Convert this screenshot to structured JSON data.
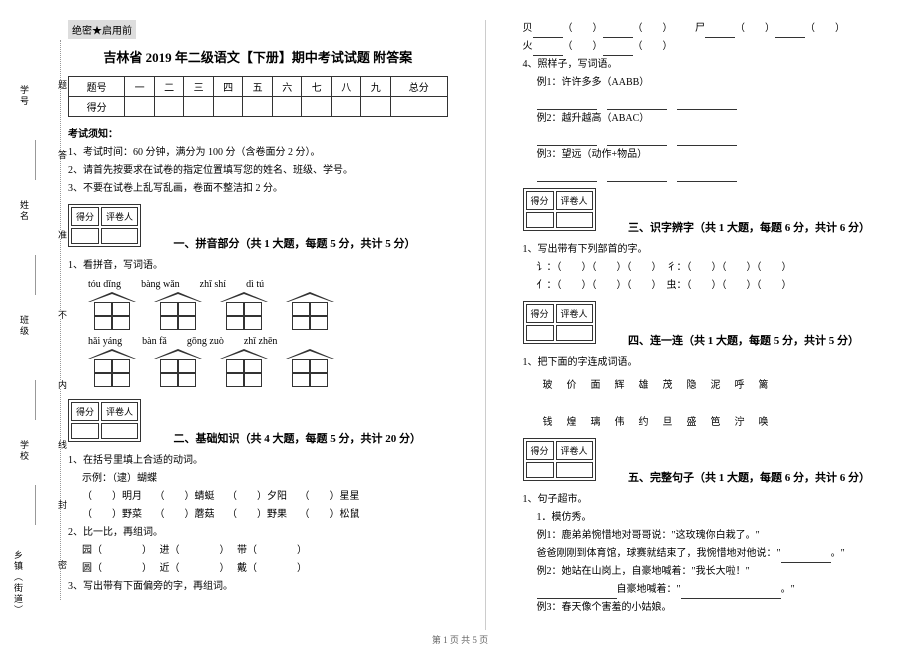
{
  "secret": "绝密★启用前",
  "title": "吉林省 2019 年二级语文【下册】期中考试试题 附答案",
  "score_table": {
    "row1": [
      "题号",
      "一",
      "二",
      "三",
      "四",
      "五",
      "六",
      "七",
      "八",
      "九",
      "总分"
    ],
    "row2_label": "得分"
  },
  "notice_hd": "考试须知：",
  "notices": [
    "1、考试时间：60 分钟，满分为 100 分（含卷面分 2 分）。",
    "2、请首先按要求在试卷的指定位置填写您的姓名、班级、学号。",
    "3、不要在试卷上乱写乱画，卷面不整洁扣 2 分。"
  ],
  "smallbox": {
    "c1": "得分",
    "c2": "评卷人"
  },
  "sec1": "一、拼音部分（共 1 大题，每题 5 分，共计 5 分）",
  "q1_1": "1、看拼音，写词语。",
  "pinyin_row1": [
    "tóu dǐng",
    "bàng wǎn",
    "zhī shí",
    "dì tú"
  ],
  "pinyin_row2": [
    "hǎi yáng",
    "bàn fǎ",
    "gōng zuò",
    "zhǐ zhēn"
  ],
  "sec2": "二、基础知识（共 4 大题，每题 5 分，共计 20 分）",
  "q2_1": "1、在括号里填上合适的动词。",
  "q2_1_ex": "示例：（逮）蝴蝶",
  "q2_1_items": [
    "（　　）明月",
    "（　　）蜻蜓",
    "（　　）夕阳",
    "（　　）星星",
    "（　　）野菜",
    "（　　）蘑菇",
    "（　　）野果",
    "（　　）松鼠"
  ],
  "q2_2": "2、比一比，再组词。",
  "q2_2_rows": [
    [
      "园（　　　　）",
      "进（　　　　）",
      "带（　　　　）"
    ],
    [
      "圆（　　　　）",
      "近（　　　　）",
      "戴（　　　　）"
    ]
  ],
  "q2_3": "3、写出带有下面偏旁的字，再组词。",
  "top_chars": {
    "l1": "贝",
    "l2": "火",
    "r1": "尸"
  },
  "q2_4": "4、照样子，写词语。",
  "q2_4_ex1": "例1：许许多多（AABB）",
  "q2_4_ex2": "例2：越升越高（ABAC）",
  "q2_4_ex3": "例3：望远（动作+物品）",
  "sec3": "三、识字辨字（共 1 大题，每题 6 分，共计 6 分）",
  "q3_1": "1、写出带有下列部首的字。",
  "q3_1_rows": [
    "讠：（　　）（　　）（　　）　彳：（　　）（　　）（　　）",
    "亻：（　　）（　　）（　　）　虫：（　　）（　　）（　　）"
  ],
  "sec4": "四、连一连（共 1 大题，每题 5 分，共计 5 分）",
  "q4_1": "1、把下面的字连成词语。",
  "q4_row1": [
    "玻",
    "价",
    "面",
    "辉",
    "雄",
    "茂",
    "隐",
    "泥",
    "呼",
    "篱"
  ],
  "q4_row2": [
    "钱",
    "煌",
    "璃",
    "伟",
    "约",
    "旦",
    "盛",
    "笆",
    "泞",
    "唤"
  ],
  "sec5": "五、完整句子（共 1 大题，每题 6 分，共计 6 分）",
  "q5_1": "1、句子超市。",
  "q5_1_1": "1．模仿秀。",
  "q5_1_ex1": "例1：鹿弟弟惋惜地对哥哥说：\"这玫瑰你白栽了。\"",
  "q5_1_line1a": "爸爸刚刚到体育馆，球赛就结束了，我惋惜地对他说：\"",
  "q5_1_line1b": "。\"",
  "q5_1_ex2": "例2：她站在山岗上，自豪地喊着：\"我长大啦！\"",
  "q5_1_line2a": "自豪地喊着：\"",
  "q5_1_line2b": "。\"",
  "q5_1_ex3": "例3：春天像个害羞的小姑娘。",
  "sidebar": {
    "l1": "乡镇（街道）",
    "l2": "学校",
    "l3": "班级",
    "l4": "姓名",
    "l5": "学号",
    "d1": "密",
    "d2": "封",
    "d3": "线",
    "d4": "内",
    "d5": "不",
    "d6": "准",
    "d7": "答",
    "d8": "题"
  },
  "footer": "第 1 页 共 5 页"
}
